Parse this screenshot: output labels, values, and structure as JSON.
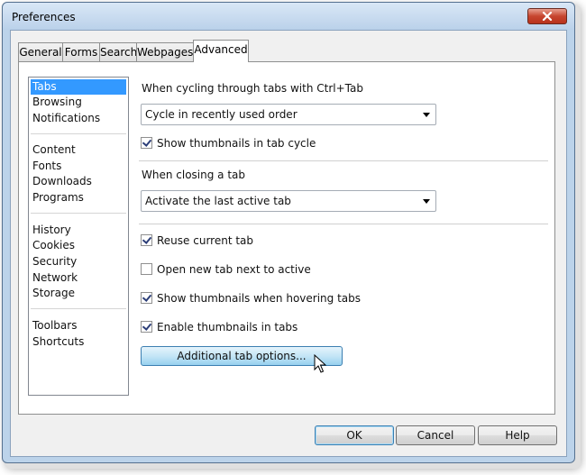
{
  "window": {
    "title": "Preferences"
  },
  "tabs": [
    {
      "label": "General"
    },
    {
      "label": "Forms"
    },
    {
      "label": "Search"
    },
    {
      "label": "Webpages"
    },
    {
      "label": "Advanced"
    }
  ],
  "sidebar": {
    "items": [
      {
        "label": "Tabs"
      },
      {
        "label": "Browsing"
      },
      {
        "label": "Notifications"
      },
      {
        "label": "Content"
      },
      {
        "label": "Fonts"
      },
      {
        "label": "Downloads"
      },
      {
        "label": "Programs"
      },
      {
        "label": "History"
      },
      {
        "label": "Cookies"
      },
      {
        "label": "Security"
      },
      {
        "label": "Network"
      },
      {
        "label": "Storage"
      },
      {
        "label": "Toolbars"
      },
      {
        "label": "Shortcuts"
      }
    ]
  },
  "cycling": {
    "heading": "When cycling through tabs with Ctrl+Tab",
    "select_value": "Cycle in recently used order",
    "show_thumbnails": {
      "label": "Show thumbnails in tab cycle",
      "checked": true
    }
  },
  "closing": {
    "heading": "When closing a tab",
    "select_value": "Activate the last active tab"
  },
  "options": [
    {
      "label": "Reuse current tab",
      "checked": true
    },
    {
      "label": "Open new tab next to active",
      "checked": false
    },
    {
      "label": "Show thumbnails when hovering tabs",
      "checked": true
    },
    {
      "label": "Enable thumbnails in tabs",
      "checked": true
    }
  ],
  "additional_button": {
    "label": "Additional tab options..."
  },
  "footer": {
    "ok_label": "OK",
    "cancel_label": "Cancel",
    "help_label": "Help"
  }
}
